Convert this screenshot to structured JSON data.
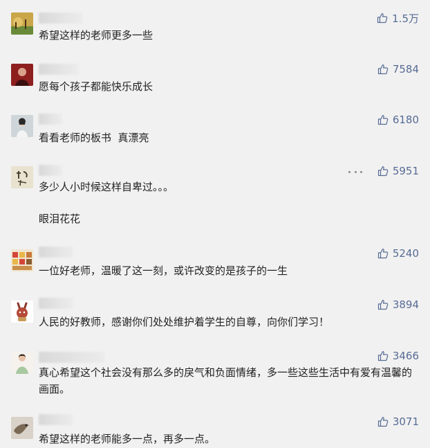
{
  "comments": [
    {
      "text": "希望这样的老师更多一些",
      "likes": "1.5万"
    },
    {
      "text": "愿每个孩子都能快乐成长",
      "likes": "7584"
    },
    {
      "text": "看看老师的板书  真漂亮",
      "likes": "6180"
    },
    {
      "text": "多少人小时候这样自卑过。。。\n\n眼泪花花",
      "likes": "5951"
    },
    {
      "text": "一位好老师，温暖了这一刻，或许改变的是孩子的一生",
      "likes": "5240"
    },
    {
      "text": "人民的好教师，感谢你们处处维护着学生的自尊，向你们学习！",
      "likes": "3894"
    },
    {
      "text": "真心希望这个社会没有那么多的戾气和负面情绪，多一些这些生活中有爱有温馨的画面。",
      "likes": "3466"
    },
    {
      "text": "希望这样的老师能多一点，再多一点。",
      "likes": "3071"
    }
  ],
  "icons": {
    "like": "thumbs-up-icon",
    "more": "more-options-icon"
  },
  "colors": {
    "background": "#f1f1f1",
    "like_count": "#576b95",
    "text": "#222222"
  }
}
